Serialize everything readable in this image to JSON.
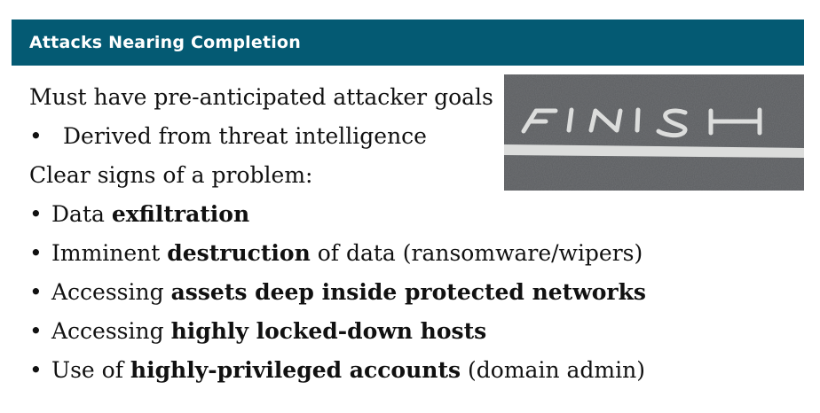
{
  "header": {
    "title": "Attacks Nearing Completion"
  },
  "content": {
    "lines": [
      {
        "text": "Must have pre-anticipated attacker goals"
      },
      {
        "bullet": "•",
        "text": "Derived from threat intelligence"
      },
      {
        "text": "Clear signs of a problem:"
      },
      {
        "bullet": "•",
        "pre": "Data ",
        "bold": "exfiltration",
        "post": ""
      },
      {
        "bullet": "•",
        "pre": "Imminent ",
        "bold": "destruction",
        "post": " of data (ransomware/wipers)"
      },
      {
        "bullet": "•",
        "pre": "Accessing ",
        "bold": "assets deep inside protected networks",
        "post": ""
      },
      {
        "bullet": "•",
        "pre": "Accessing ",
        "bold": "highly locked-down hosts",
        "post": ""
      },
      {
        "bullet": "•",
        "pre": "Use of ",
        "bold": "highly-privileged accounts",
        "post": " (domain admin)"
      }
    ]
  },
  "image": {
    "painted_text": "FINISH"
  },
  "colors": {
    "header_bg": "#045a73",
    "header_text": "#ffffff",
    "asphalt": "#55575a"
  }
}
